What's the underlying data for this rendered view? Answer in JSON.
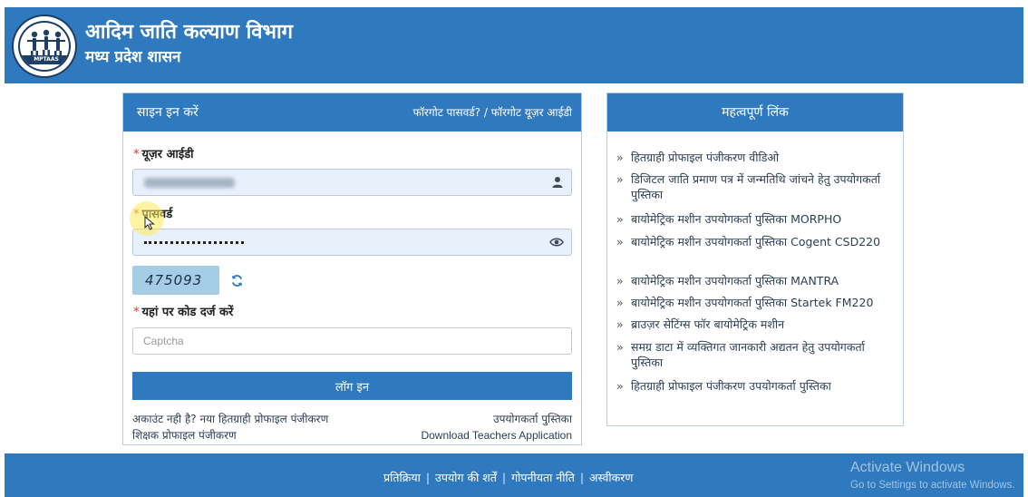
{
  "header": {
    "title": "आदिम जाति कल्याण विभाग",
    "subtitle": "मध्य प्रदेश शासन",
    "logo_text": "MPTAAS"
  },
  "login": {
    "panel_title": "साइन इन करें",
    "forgot_links": "फॉरगोट पासवर्ड? / फॉरगोट यूज़र आईडी",
    "user_id_label": "यूज़र आईडी",
    "password_label": "पासवर्ड",
    "captcha_code": "475093",
    "captcha_label": "यहां पर कोड दर्ज करें",
    "captcha_placeholder": "Captcha",
    "login_button": "लॉग इन",
    "no_account": "अकाउंट नही है? नया हितग्राही प्रोफाइल पंजीकरण",
    "teacher_registration": "शिक्षक प्रोफाइल पंजीकरण",
    "user_manual": "उपयोगकर्ता पुस्तिका",
    "download_teachers": "Download Teachers Application"
  },
  "links": {
    "title": "महत्वपूर्ण लिंक",
    "items": [
      "हितग्राही प्रोफाइल पंजीकरण वीडिओ",
      "डिजिटल जाति प्रमाण पत्र में जन्मतिथि जांचने हेतु उपयोगकर्ता पुस्तिका",
      "बायोमेट्रिक मशीन उपयोगकर्ता पुस्तिका MORPHO",
      "बायोमेट्रिक मशीन उपयोगकर्ता पुस्तिका Cogent CSD220",
      "बायोमेट्रिक मशीन उपयोगकर्ता पुस्तिका MANTRA",
      "बायोमेट्रिक मशीन उपयोगकर्ता पुस्तिका Startek FM220",
      "ब्राउज़र सेटिंग्स फॉर बायोमेट्रिक मशीन",
      "समग्र डाटा में व्यक्तिगत जानकारी अद्यतन हेतु उपयोगकर्ता पुस्तिका",
      "हितग्राही प्रोफाइल पंजीकरण उपयोगकर्ता पुस्तिका"
    ]
  },
  "footer": {
    "links": [
      "प्रतिक्रिया",
      "उपयोग की शर्तें",
      "गोपनीयता नीति",
      "अस्वीकरण"
    ]
  },
  "watermark": {
    "line1": "Activate Windows",
    "line2": "Go to Settings to activate Windows."
  },
  "colors": {
    "brand_blue": "#2f79bf",
    "field_bg": "#e8f0fb",
    "required_red": "#d23a2b"
  }
}
